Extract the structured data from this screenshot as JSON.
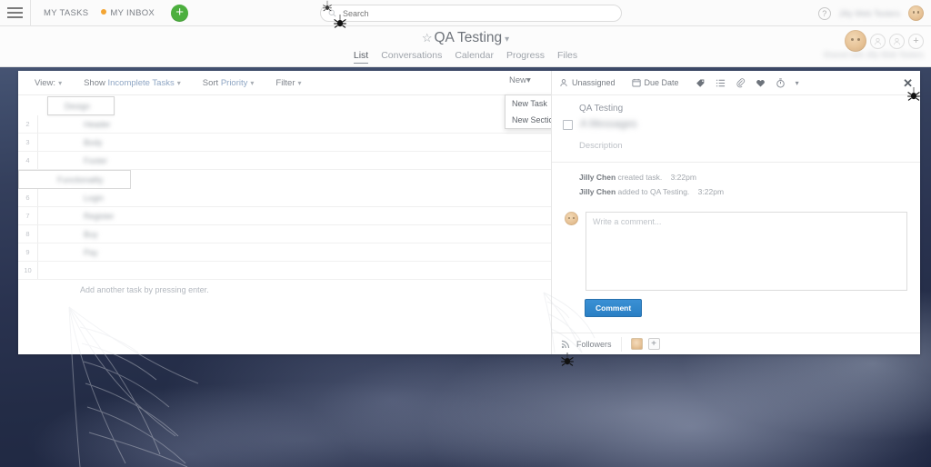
{
  "topbar": {
    "menu_icon": "hamburger-icon",
    "my_tasks": "MY TASKS",
    "my_inbox": "MY INBOX",
    "add_label": "+",
    "help_label": "?",
    "user_name_blurred": "Jilly Web Testers",
    "search": {
      "placeholder": "Search",
      "value": "",
      "icon": "search-icon"
    }
  },
  "project": {
    "title": "QA Testing",
    "star_icon": "star-outline-icon",
    "caret_icon": "chevron-down-icon",
    "tabs": [
      {
        "label": "List",
        "active": true
      },
      {
        "label": "Conversations",
        "active": false
      },
      {
        "label": "Calendar",
        "active": false
      },
      {
        "label": "Progress",
        "active": false
      },
      {
        "label": "Files",
        "active": false
      }
    ],
    "members_blurred": "Shared with Jilly Web Testers"
  },
  "list_toolbar": {
    "view_label": "View:",
    "show_label": "Show",
    "show_value": "Incomplete Tasks",
    "sort_label": "Sort",
    "sort_value": "Priority",
    "filter_label": "Filter",
    "new_label": "New"
  },
  "new_menu": {
    "items": [
      {
        "label": "New Task",
        "shortcut": "↵"
      },
      {
        "label": "New Section",
        "shortcut": ""
      }
    ]
  },
  "task_list": {
    "rows": [
      {
        "num": "",
        "text": "Design",
        "type": "editing"
      },
      {
        "num": "2",
        "text": "Header",
        "type": "task"
      },
      {
        "num": "3",
        "text": "Body",
        "type": "task"
      },
      {
        "num": "4",
        "text": "Footer",
        "type": "task"
      },
      {
        "num": "",
        "text": "Functionality",
        "type": "section-edit"
      },
      {
        "num": "6",
        "text": "Login",
        "type": "task"
      },
      {
        "num": "7",
        "text": "Register",
        "type": "task"
      },
      {
        "num": "8",
        "text": "Buy",
        "type": "task"
      },
      {
        "num": "9",
        "text": "Pay",
        "type": "task"
      },
      {
        "num": "10",
        "text": "",
        "type": "task"
      }
    ],
    "add_hint": "Add another task by pressing enter."
  },
  "detail_toolbar": {
    "assignee": "Unassigned",
    "assignee_icon": "person-icon",
    "due_date": "Due Date",
    "due_date_icon": "calendar-icon",
    "icons": [
      "tag-icon",
      "subtask-icon",
      "attachment-icon",
      "heart-icon",
      "timer-icon",
      "chevron-down-icon"
    ],
    "close_icon": "close-icon",
    "close_label": "✕"
  },
  "detail": {
    "project_label": "QA Testing",
    "task_name_blurred": "A Messages",
    "description_placeholder": "Description",
    "activity": [
      {
        "actor": "Jilly Chen",
        "action": "created task.",
        "time": "3:22pm"
      },
      {
        "actor": "Jilly Chen",
        "action": "added to QA Testing.",
        "time": "3:22pm"
      }
    ],
    "comment_placeholder": "Write a comment...",
    "comment_value": "",
    "comment_button": "Comment",
    "followers_label": "Followers",
    "followers_icon": "rss-icon",
    "add_follower_label": "+"
  },
  "colors": {
    "accent_blue": "#2a7fc4",
    "green_add": "#4caf3e",
    "orange_dot": "#f3a533",
    "link_blue": "#8fa6c4",
    "background_sky": "#2a3350"
  },
  "decorations": {
    "spiders": 4,
    "spiderweb": "spiderweb-icon"
  }
}
